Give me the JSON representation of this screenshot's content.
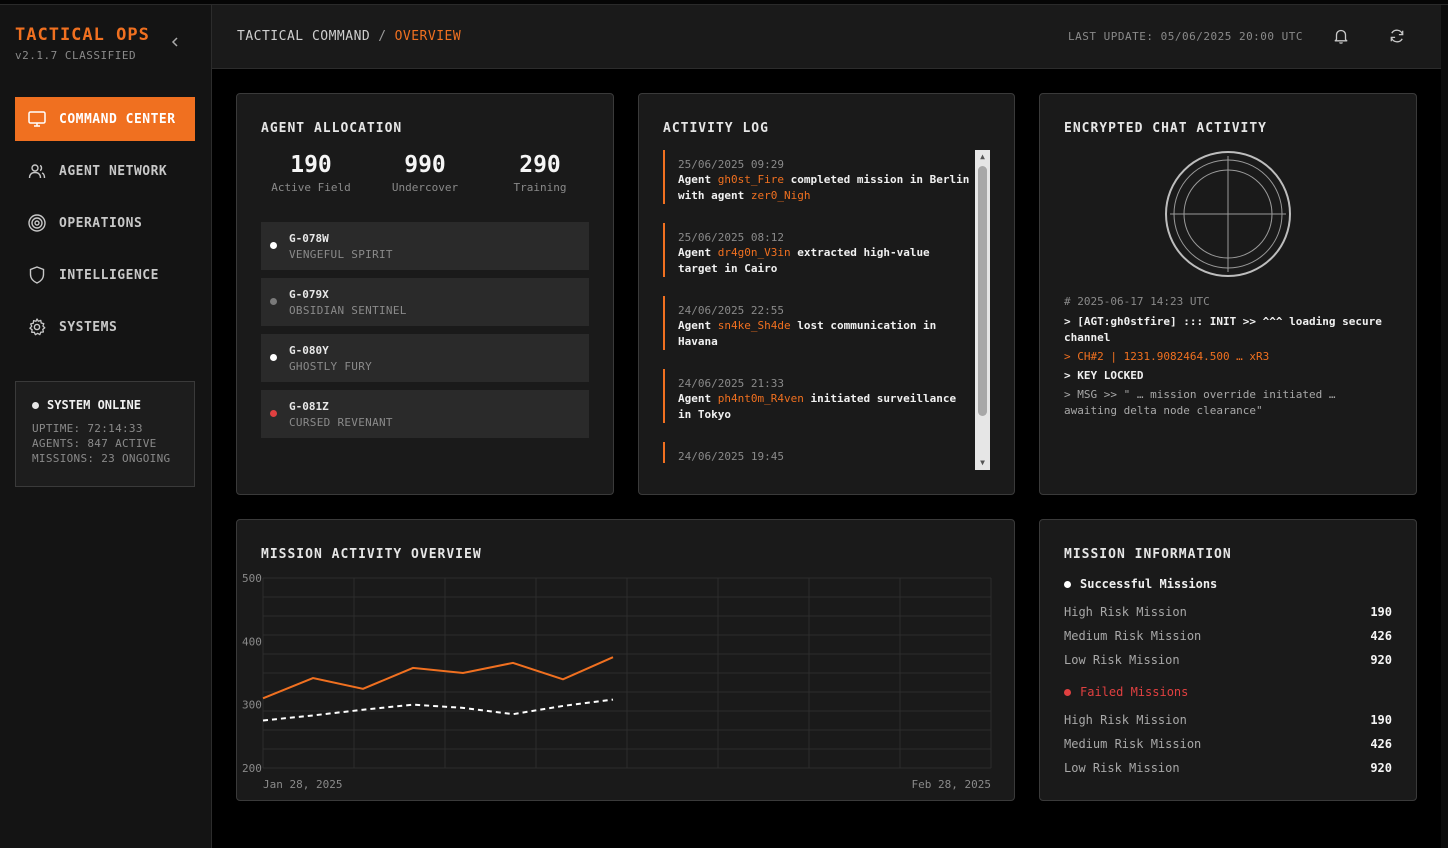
{
  "app": {
    "title": "TACTICAL OPS",
    "version": "v2.1.7 CLASSIFIED",
    "collapse_glyph": "‹"
  },
  "colors": {
    "accent": "#f07020",
    "danger": "#e04040",
    "background": "#000000",
    "panel": "#1a1a1a"
  },
  "sidebar": {
    "items": [
      {
        "label": "COMMAND CENTER",
        "icon": "monitor-icon",
        "active": true
      },
      {
        "label": "AGENT NETWORK",
        "icon": "users-icon",
        "active": false
      },
      {
        "label": "OPERATIONS",
        "icon": "target-icon",
        "active": false
      },
      {
        "label": "INTELLIGENCE",
        "icon": "shield-icon",
        "active": false
      },
      {
        "label": "SYSTEMS",
        "icon": "gear-icon",
        "active": false
      }
    ],
    "status": {
      "title": "SYSTEM ONLINE",
      "uptime": "UPTIME: 72:14:33",
      "agents": "AGENTS: 847 ACTIVE",
      "missions": "MISSIONS: 23 ONGOING"
    }
  },
  "header": {
    "breadcrumb_root": "TACTICAL COMMAND",
    "breadcrumb_sep": "/",
    "breadcrumb_current": "OVERVIEW",
    "last_update": "LAST UPDATE: 05/06/2025 20:00 UTC",
    "icons": [
      "bell-icon",
      "refresh-icon"
    ]
  },
  "agent_allocation": {
    "title": "AGENT ALLOCATION",
    "stats": [
      {
        "value": "190",
        "label": "Active Field"
      },
      {
        "value": "990",
        "label": "Undercover"
      },
      {
        "value": "290",
        "label": "Training"
      }
    ],
    "agents": [
      {
        "id": "G-078W",
        "name": "VENGEFUL SPIRIT",
        "status_color": "#ffffff"
      },
      {
        "id": "G-079X",
        "name": "OBSIDIAN SENTINEL",
        "status_color": "#7a7a7a"
      },
      {
        "id": "G-080Y",
        "name": "GHOSTLY FURY",
        "status_color": "#ffffff"
      },
      {
        "id": "G-081Z",
        "name": "CURSED REVENANT",
        "status_color": "#e04040"
      }
    ]
  },
  "activity_log": {
    "title": "ACTIVITY LOG",
    "entries": [
      {
        "time": "25/06/2025 09:29",
        "pre": "Agent ",
        "agent": "gh0st_Fire",
        "mid": " completed mission in Berlin with agent ",
        "agent2": "zer0_Nigh",
        "post": ""
      },
      {
        "time": "25/06/2025 08:12",
        "pre": "Agent ",
        "agent": "dr4g0n_V3in",
        "mid": " extracted high-value target in Cairo",
        "agent2": "",
        "post": ""
      },
      {
        "time": "24/06/2025 22:55",
        "pre": "Agent ",
        "agent": "sn4ke_Sh4de",
        "mid": " lost communication in Havana",
        "agent2": "",
        "post": ""
      },
      {
        "time": "24/06/2025 21:33",
        "pre": "Agent ",
        "agent": "ph4nt0m_R4ven",
        "mid": " initiated surveillance in Tokyo",
        "agent2": "",
        "post": ""
      },
      {
        "time": "24/06/2025 19:45",
        "pre": "",
        "agent": "",
        "mid": "",
        "agent2": "",
        "post": ""
      }
    ]
  },
  "chat": {
    "title": "ENCRYPTED CHAT ACTIVITY",
    "timestamp": "# 2025-06-17 14:23 UTC",
    "line1": "> [AGT:gh0stfire] ::: INIT >> ^^^ loading secure channel",
    "line2": "> CH#2 | 1231.9082464.500 … xR3",
    "line3": "> KEY LOCKED",
    "line4": "> MSG >> \" … mission override initiated … awaiting delta node clearance\""
  },
  "mission_activity": {
    "title": "MISSION ACTIVITY OVERVIEW",
    "x_start_label": "Jan 28, 2025",
    "x_end_label": "Feb 28, 2025"
  },
  "chart_data": {
    "type": "line",
    "title": "MISSION ACTIVITY OVERVIEW",
    "xlabel": "",
    "ylabel": "",
    "x_labels": [
      "Jan 28, 2025",
      "Feb 28, 2025"
    ],
    "x": [
      0,
      1,
      2,
      3,
      4,
      5,
      6,
      7
    ],
    "ylim": [
      200,
      500
    ],
    "yticks": [
      500,
      400,
      300,
      200
    ],
    "grid": true,
    "series": [
      {
        "style": "solid",
        "color": "#f07020",
        "values": [
          310,
          342,
          325,
          358,
          350,
          366,
          340,
          375
        ]
      },
      {
        "style": "dashed",
        "color": "#ffffff",
        "values": [
          275,
          283,
          292,
          300,
          295,
          285,
          298,
          308
        ]
      }
    ]
  },
  "mission_info": {
    "title": "MISSION INFORMATION",
    "successful": {
      "label": "Successful Missions",
      "rows": [
        {
          "label": "High Risk Mission",
          "value": "190"
        },
        {
          "label": "Medium Risk Mission",
          "value": "426"
        },
        {
          "label": "Low Risk Mission",
          "value": "920"
        }
      ]
    },
    "failed": {
      "label": "Failed Missions",
      "rows": [
        {
          "label": "High Risk Mission",
          "value": "190"
        },
        {
          "label": "Medium Risk Mission",
          "value": "426"
        },
        {
          "label": "Low Risk Mission",
          "value": "920"
        }
      ]
    }
  }
}
